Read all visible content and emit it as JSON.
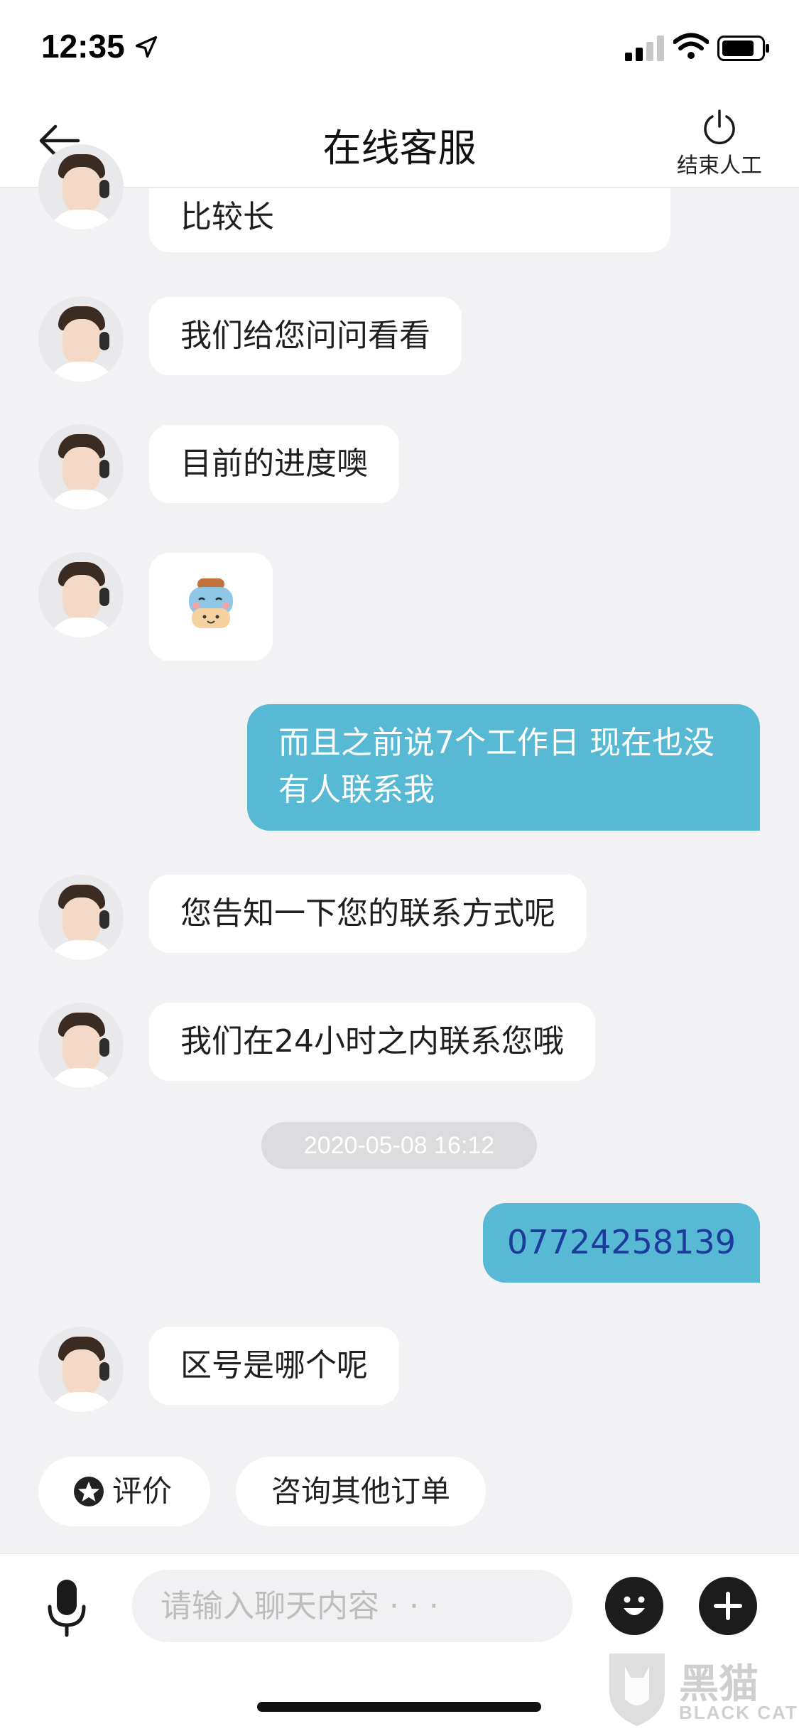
{
  "status_bar": {
    "time": "12:35",
    "icons": [
      "location-arrow-icon",
      "signal-icon",
      "wifi-icon",
      "battery-icon"
    ]
  },
  "nav": {
    "title": "在线客服",
    "end_label": "结束人工",
    "icons": [
      "back-arrow-icon",
      "power-icon"
    ]
  },
  "messages": [
    {
      "sender": "agent",
      "text": "比较长"
    },
    {
      "sender": "agent",
      "text": "我们给您问问看看"
    },
    {
      "sender": "agent",
      "text": "目前的进度噢"
    },
    {
      "sender": "agent",
      "sticker": "cow-sticker"
    },
    {
      "sender": "user",
      "text": "而且之前说7个工作日 现在也没有人联系我"
    },
    {
      "sender": "agent",
      "text": "您告知一下您的联系方式呢"
    },
    {
      "sender": "agent",
      "text": "我们在24小时之内联系您哦"
    },
    {
      "sender": "user",
      "text": "07724258139"
    },
    {
      "sender": "agent",
      "text": "区号是哪个呢"
    }
  ],
  "timestamp": "2020-05-08 16:12",
  "quick_replies": {
    "rate": "评价",
    "other_orders": "咨询其他订单"
  },
  "input": {
    "placeholder": "请输入聊天内容 · · ·",
    "icons": [
      "microphone-icon",
      "emoji-icon",
      "plus-icon"
    ]
  },
  "watermark": {
    "text_cn": "黑猫",
    "text_en": "BLACK CAT"
  },
  "colors": {
    "user_bubble": "#57b9d3",
    "background": "#f2f2f4",
    "phone_link": "#1c3b9b"
  }
}
